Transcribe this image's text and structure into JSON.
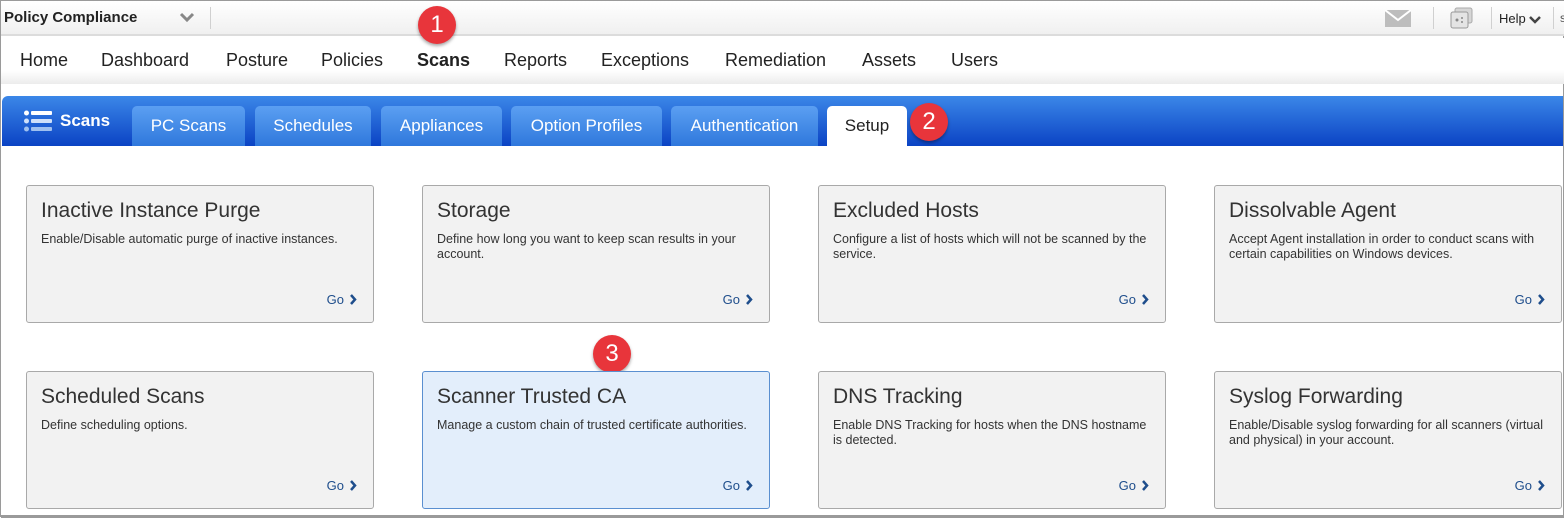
{
  "topbar": {
    "app_title": "Policy Compliance",
    "help_label": "Help",
    "user_label": "s"
  },
  "main_nav": {
    "items": [
      {
        "label": "Home",
        "active": false
      },
      {
        "label": "Dashboard",
        "active": false
      },
      {
        "label": "Posture",
        "active": false
      },
      {
        "label": "Policies",
        "active": false
      },
      {
        "label": "Scans",
        "active": true
      },
      {
        "label": "Reports",
        "active": false
      },
      {
        "label": "Exceptions",
        "active": false
      },
      {
        "label": "Remediation",
        "active": false
      },
      {
        "label": "Assets",
        "active": false
      },
      {
        "label": "Users",
        "active": false
      }
    ]
  },
  "tabbar": {
    "section_title": "Scans",
    "tabs": [
      {
        "label": "PC Scans",
        "active": false
      },
      {
        "label": "Schedules",
        "active": false
      },
      {
        "label": "Appliances",
        "active": false
      },
      {
        "label": "Option Profiles",
        "active": false
      },
      {
        "label": "Authentication",
        "active": false
      },
      {
        "label": "Setup",
        "active": true
      }
    ]
  },
  "badges": [
    "1",
    "2",
    "3"
  ],
  "cards": [
    {
      "title": "Inactive Instance Purge",
      "description": "Enable/Disable automatic purge of inactive instances.",
      "link": "Go",
      "highlighted": false
    },
    {
      "title": "Storage",
      "description": "Define how long you want to keep scan results in your account.",
      "link": "Go",
      "highlighted": false
    },
    {
      "title": "Excluded Hosts",
      "description": "Configure a list of hosts which will not be scanned by the service.",
      "link": "Go",
      "highlighted": false
    },
    {
      "title": "Dissolvable Agent",
      "description": "Accept Agent installation in order to conduct scans with certain capabilities on Windows devices.",
      "link": "Go",
      "highlighted": false
    },
    {
      "title": "Scheduled Scans",
      "description": "Define scheduling options.",
      "link": "Go",
      "highlighted": false
    },
    {
      "title": "Scanner Trusted CA",
      "description": "Manage a custom chain of trusted certificate authorities.",
      "link": "Go",
      "highlighted": true
    },
    {
      "title": "DNS Tracking",
      "description": "Enable DNS Tracking for hosts when the DNS hostname is detected.",
      "link": "Go",
      "highlighted": false
    },
    {
      "title": "Syslog Forwarding",
      "description": "Enable/Disable syslog forwarding for all scanners (virtual and physical) in your account.",
      "link": "Go",
      "highlighted": false
    }
  ],
  "colors": {
    "accent_blue": "#0b43c4",
    "badge_red": "#e8353b",
    "link_blue": "#1f4e8c",
    "highlight_card": "#e3eefb"
  }
}
